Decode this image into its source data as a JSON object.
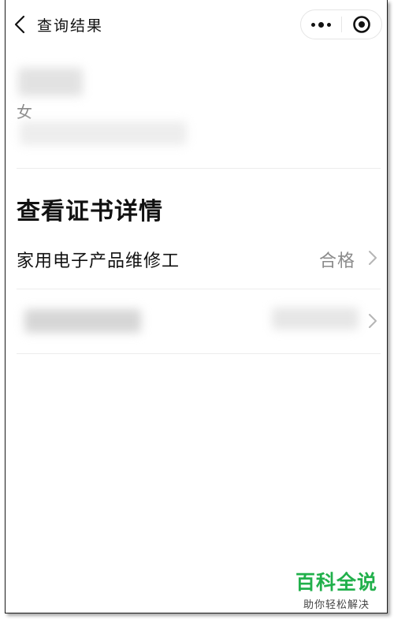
{
  "nav": {
    "title": "查询结果",
    "back_icon": "back-arrow-icon",
    "menu_icon": "more-dots-icon",
    "close_icon": "target-close-icon"
  },
  "profile": {
    "gender": "女"
  },
  "certificates": {
    "heading": "查看证书详情",
    "items": [
      {
        "name": "家用电子产品维修工",
        "status": "合格"
      },
      {
        "name": "",
        "status": ""
      }
    ]
  },
  "watermark": {
    "title": "百科全说",
    "subtitle": "助你轻松解决"
  },
  "colors": {
    "accent": "#21b04b",
    "text_primary": "#111111",
    "text_secondary": "#8a8a8a",
    "separator": "#ececec"
  }
}
